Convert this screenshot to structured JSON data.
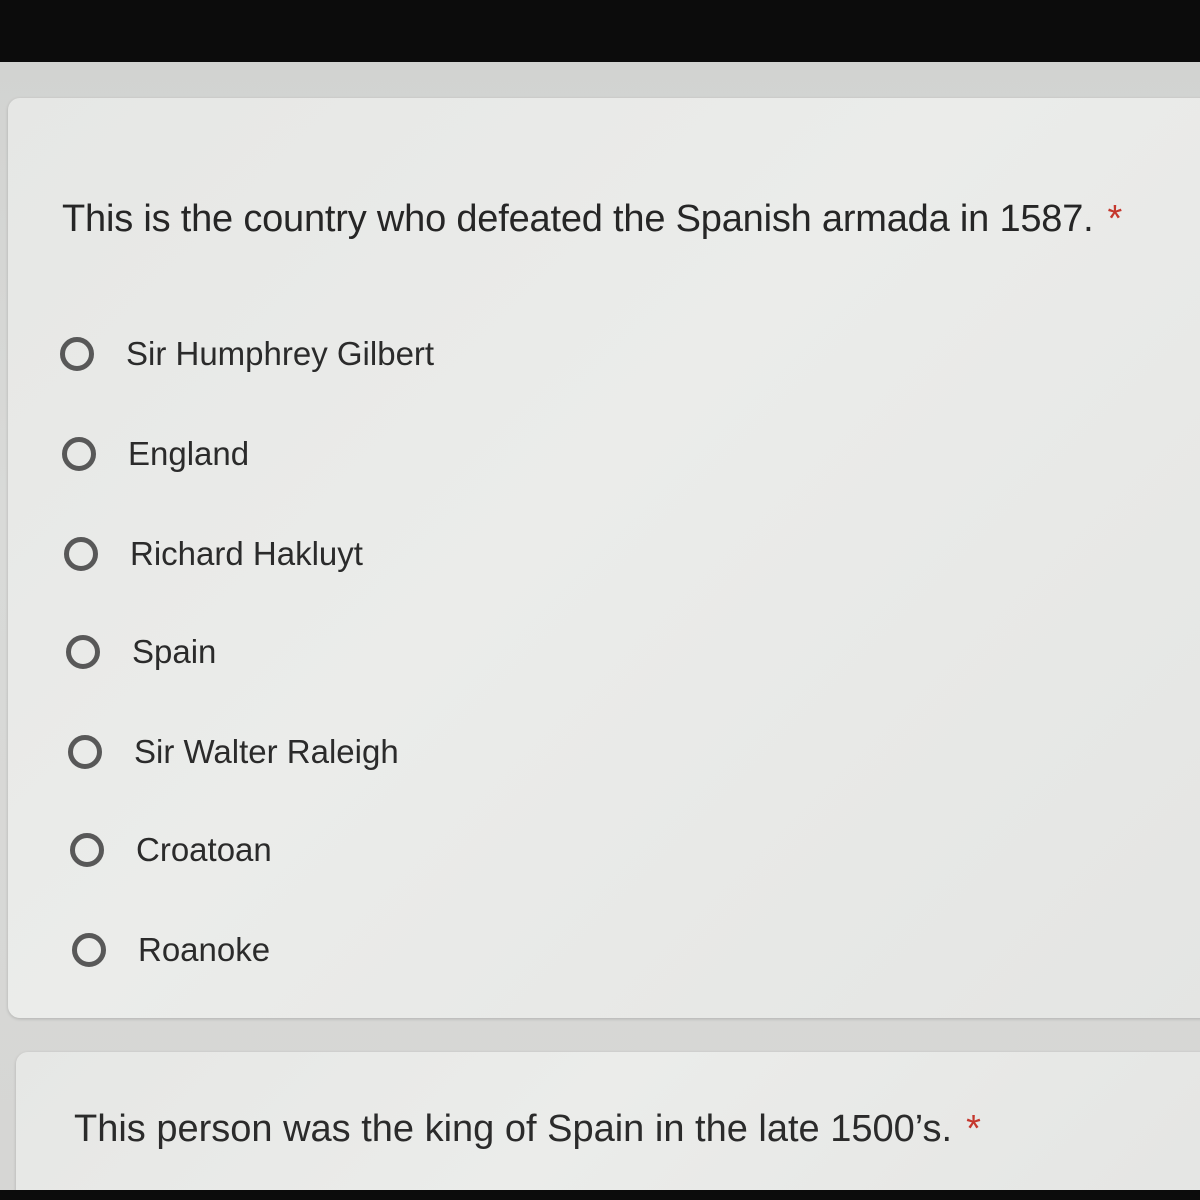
{
  "question1": {
    "title": "This is the country who defeated the Spanish armada in 1587.",
    "required_marker": "*",
    "options": [
      "Sir Humphrey Gilbert",
      "England",
      "Richard Hakluyt",
      "Spain",
      "Sir Walter Raleigh",
      "Croatoan",
      "Roanoke"
    ]
  },
  "question2": {
    "title": "This person was the king of Spain in the late 1500’s.",
    "required_marker": "*"
  },
  "colors": {
    "required_asterisk": "#c5372d",
    "radio_border": "#585858",
    "card_background": "#e8e9e7"
  },
  "icons": {
    "radio_unselected": "radio-unselected-icon"
  }
}
